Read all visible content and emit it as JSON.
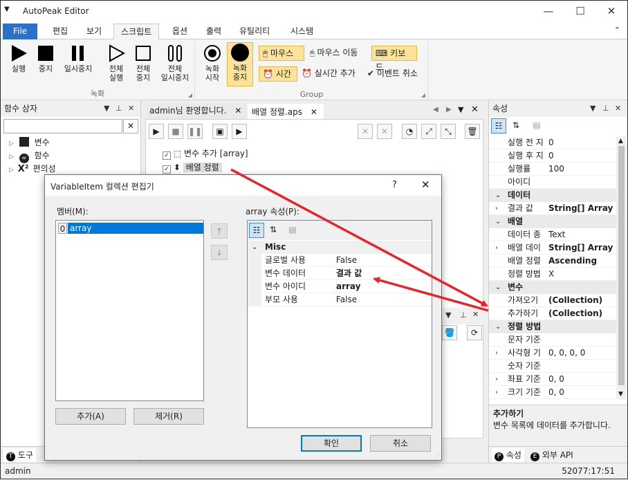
{
  "app": {
    "title": "AutoPeak Editor"
  },
  "ribbon": {
    "tabs": [
      "File",
      "편집",
      "보기",
      "스크립트",
      "옵션",
      "출력",
      "유틸리티",
      "시스템"
    ],
    "active_tab": "스크립트",
    "groups": {
      "record": "녹화",
      "group": "Group"
    },
    "buttons": {
      "run": "실행",
      "stop": "중지",
      "pause": "일시중지",
      "run_all_1": "전체",
      "run_all_2": "실행",
      "stop_all_1": "전체",
      "stop_all_2": "중지",
      "pause_all_1": "전체",
      "pause_all_2": "일시중지",
      "rec_start_1": "녹화",
      "rec_start_2": "시작",
      "rec_stop_1": "녹화",
      "rec_stop_2": "중지",
      "mouse": "마우스",
      "mouse_move": "마우스 이동",
      "keyboard": "키보드",
      "time": "시간",
      "realtime_add": "실시간 추가",
      "event_cancel": "이벤트 취소"
    }
  },
  "left_panel": {
    "title": "함수 상자",
    "tree": [
      "변수",
      "함수",
      "편의성"
    ],
    "bottom_tabs": [
      "도구"
    ]
  },
  "documents": {
    "tabs": [
      "admin님 환영합니다.",
      "배열 정렬.aps"
    ],
    "active": "배열 정렬.aps",
    "lines": [
      {
        "text": "변수 추가 [array]"
      },
      {
        "text": "배열 정렬"
      }
    ]
  },
  "right_panel": {
    "title": "속성",
    "rows": [
      {
        "type": "row",
        "name": "실행 전 지",
        "value": "0"
      },
      {
        "type": "row",
        "name": "실행 후 지",
        "value": "0"
      },
      {
        "type": "row",
        "name": "실행률",
        "value": "100"
      },
      {
        "type": "row",
        "name": "아이디",
        "value": ""
      },
      {
        "type": "cat",
        "name": "데이터"
      },
      {
        "type": "row",
        "name": "결과 값",
        "value": "String[] Array",
        "bold": true,
        "expand": true
      },
      {
        "type": "cat",
        "name": "배열"
      },
      {
        "type": "row",
        "name": "데이터 종",
        "value": "Text"
      },
      {
        "type": "row",
        "name": "배열 데이",
        "value": "String[] Array",
        "bold": true,
        "expand": true
      },
      {
        "type": "row",
        "name": "배열 정렬",
        "value": "Ascending",
        "bold": true
      },
      {
        "type": "row",
        "name": "정렬 방법",
        "value": "X"
      },
      {
        "type": "cat",
        "name": "변수"
      },
      {
        "type": "row",
        "name": "가져오기",
        "value": "(Collection)",
        "bold": true
      },
      {
        "type": "row",
        "name": "추가하기",
        "value": "(Collection)",
        "bold": true
      },
      {
        "type": "cat",
        "name": "정렬 방법"
      },
      {
        "type": "row",
        "name": "문자 기준",
        "value": ""
      },
      {
        "type": "row",
        "name": "사각형 기",
        "value": "0, 0, 0, 0",
        "expand": true
      },
      {
        "type": "row",
        "name": "숫자 기준",
        "value": ""
      },
      {
        "type": "row",
        "name": "좌표 기준",
        "value": "0, 0",
        "expand": true
      },
      {
        "type": "row",
        "name": "크기 기준",
        "value": "0, 0",
        "expand": true
      }
    ],
    "desc_title": "추가하기",
    "desc_text": "변수 목록에 데이터를 추가합니다.",
    "bottom_tabs": [
      "속성",
      "외부 API"
    ]
  },
  "dialog": {
    "title": "VariableItem 컬렉션 편집기",
    "help": "?",
    "members_label": "멤버(M):",
    "members": [
      {
        "index": "0",
        "name": "array"
      }
    ],
    "props_label": "array 속성(P):",
    "category": "Misc",
    "props": [
      {
        "name": "글로벌 사용",
        "value": "False",
        "bold": false
      },
      {
        "name": "변수 데이터",
        "value": "결과 값",
        "bold": true
      },
      {
        "name": "변수 아이디",
        "value": "array",
        "bold": true
      },
      {
        "name": "부모 사용",
        "value": "False",
        "bold": false
      }
    ],
    "add": "추가(A)",
    "remove": "제거(R)",
    "ok": "확인",
    "cancel": "취소"
  },
  "status": {
    "left": "admin",
    "right": "52077:17:51"
  },
  "colors": {
    "accent": "#2a72c8",
    "highlight": "#fbe49a",
    "arrow": "#e8242a",
    "selection": "#0078d7"
  }
}
